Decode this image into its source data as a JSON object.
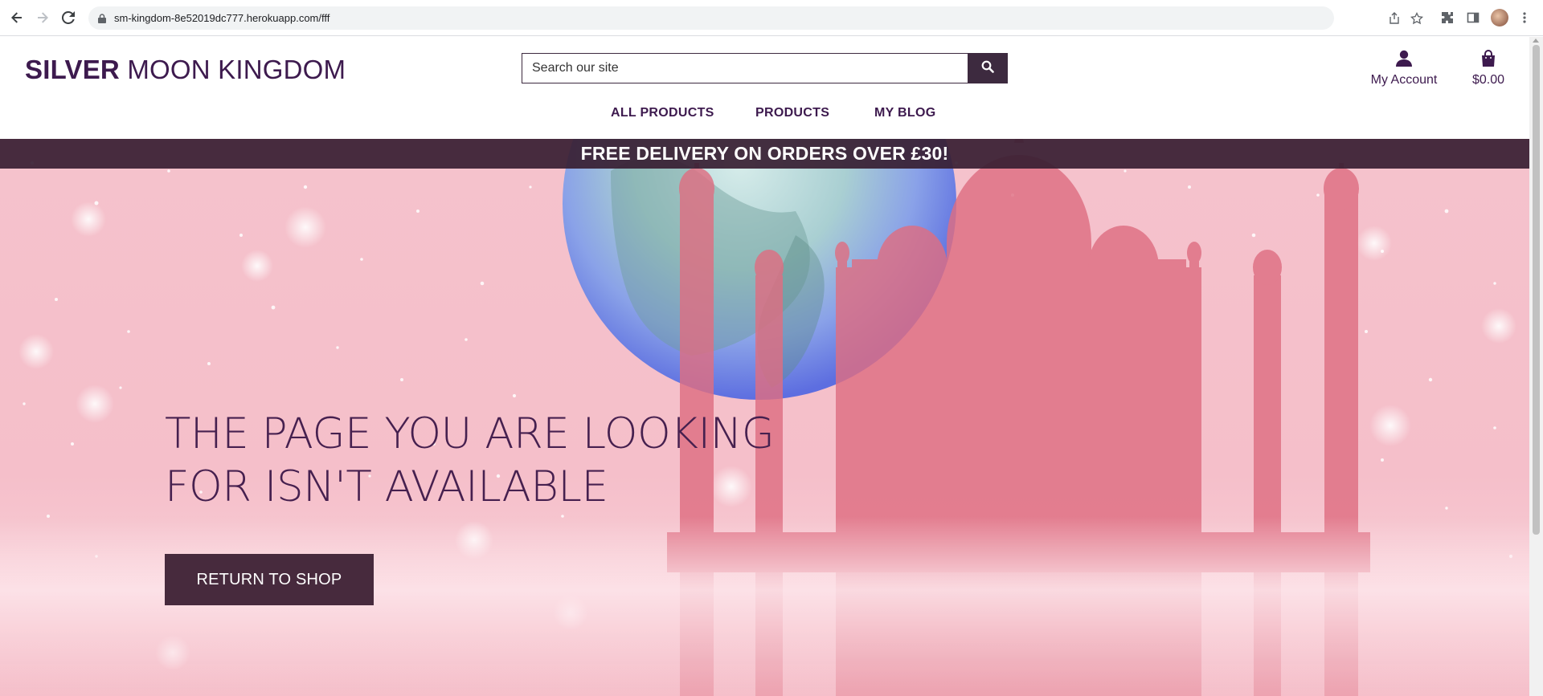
{
  "browser": {
    "url": "sm-kingdom-8e52019dc777.herokuapp.com/fff",
    "icons": [
      "back-arrow-icon",
      "forward-arrow-icon",
      "reload-icon",
      "lock-icon",
      "share-icon",
      "star-icon",
      "extensions-icon",
      "side-panel-icon",
      "profile-avatar",
      "more-menu-icon"
    ]
  },
  "site": {
    "logo_bold": "SILVER",
    "logo_rest": " MOON KINGDOM",
    "search_placeholder": "Search our site",
    "account_label": "My Account",
    "cart_total": "$0.00",
    "nav": [
      "ALL PRODUCTS",
      "PRODUCTS",
      "MY BLOG"
    ],
    "banner": "FREE DELIVERY ON ORDERS OVER £30!"
  },
  "hero": {
    "title_line1": "THE PAGE YOU ARE LOOKING",
    "title_line2": "FOR ISN'T AVAILABLE",
    "button_label": "RETURN TO SHOP"
  },
  "colors": {
    "brand": "#3d1a4e",
    "button": "#472a3d",
    "banner": "#371e32",
    "hero_pink": "#f5c2cc"
  }
}
